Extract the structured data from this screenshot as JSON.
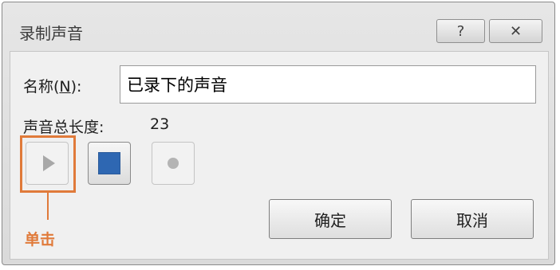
{
  "window": {
    "title": "录制声音",
    "help_symbol": "?",
    "close_symbol": "✕"
  },
  "form": {
    "name_label_prefix": "名称(",
    "name_label_key": "N",
    "name_label_suffix": "):",
    "name_value": "已录下的声音",
    "length_label": "声音总长度:",
    "length_value": "23"
  },
  "controls": {
    "play_icon": "play-icon",
    "stop_icon": "stop-icon",
    "record_icon": "record-icon",
    "stop_color": "#2e67b2"
  },
  "annotation": {
    "callout_text": "单击",
    "color": "#e07a3a"
  },
  "buttons": {
    "ok_label": "确定",
    "cancel_label": "取消"
  }
}
